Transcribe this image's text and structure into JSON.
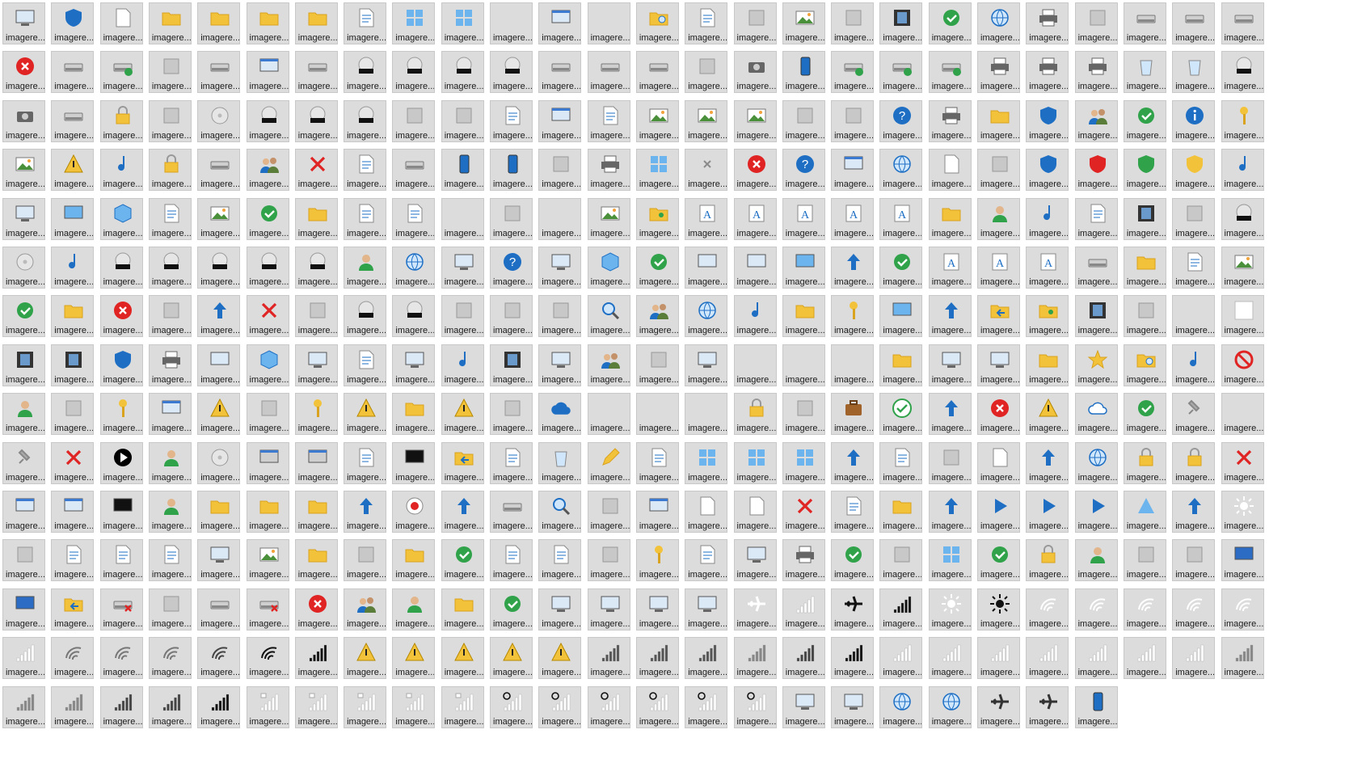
{
  "label": "imagere...",
  "icons": [
    [
      "monitor-settings-icon",
      "windows-shield-icon",
      "blank-document-icon",
      "folder-icon",
      "folder-icon",
      "folder-icon",
      "folder-open-icon",
      "magnifier-document-icon",
      "tiles-icon",
      "tiles-icon",
      "blank-icon",
      "window-icon",
      "blank-icon",
      "folder-search-icon",
      "document-lines-icon",
      "envelope-icon",
      "picture-icon",
      "ruler-sheet-icon",
      "film-strip-icon",
      "monitor-check-icon",
      "network-globe-icon",
      "printer-icon",
      "presentation-icon",
      "drive-icon",
      "drive-icon",
      "drive-icon"
    ],
    [
      "drive-error-icon",
      "drive-icon",
      "drive-green-icon",
      "chip-icon",
      "drive-icon",
      "drive-windows-icon",
      "disc-drive-icon",
      "dvd-r-icon",
      "dvd-ram-icon",
      "dvd-rom-icon",
      "dvd-rw-icon",
      "floppy-drive-icon",
      "drive-icon",
      "server-drive-icon",
      "network-pc-icon",
      "camcorder-icon",
      "phone-icon",
      "drive-network-ok-icon",
      "drive-network-ok-icon",
      "drive-network-ok-icon",
      "printer-icon",
      "printer-icon",
      "printer-green-icon",
      "recycle-bin-icon",
      "recycle-bin-icon",
      "dvd-drive-icon"
    ],
    [
      "camera-icon",
      "drive-icon",
      "lock-icon",
      "sd-card-icon",
      "disc-icon",
      "cd-r-icon",
      "cd-rom-icon",
      "cd-rw-icon",
      "notebook-icon",
      "audio-device-icon",
      "gear-document-icon",
      "settings-window-icon",
      "document-icon",
      "picture-frame-icon",
      "picture-icon",
      "landscape-icon",
      "network-share-icon",
      "network-share-icon",
      "help-drive-icon",
      "printer-icon",
      "font-folder-icon",
      "shield-icon",
      "users-icon",
      "checklist-screen-icon",
      "info-icon",
      "key-icon"
    ],
    [
      "picture-icon",
      "warning-icon",
      "music-disc-icon",
      "clock-circle-icon",
      "camera-drive-icon",
      "users-icon",
      "red-x-icon",
      "document-lines-icon",
      "drive-icon",
      "tablet-icon",
      "phone-icon",
      "projector-icon",
      "scanner-icon",
      "tiles-icon",
      "small-x-icon",
      "error-icon",
      "help-icon",
      "window-blue-icon",
      "globe-monitor-icon",
      "blank-document-icon",
      "cursor-icon",
      "shield-help-icon",
      "shield-error-icon",
      "shield-check-icon",
      "shield-warning-icon",
      "music-note-icon"
    ],
    [
      "laptop-icon",
      "screen-blue-icon",
      "package-icon",
      "document-lines-icon",
      "landscape-icon",
      "checklist-icon",
      "star-folder-icon",
      "list-icon",
      "clock-document-icon",
      "blank-icon",
      "network-icon",
      "blank-icon",
      "picture-icon",
      "user-folder-icon",
      "font-a-icon",
      "font-t-icon",
      "font-c-icon",
      "font-o-icon",
      "font-a-icon",
      "font-folder-icon",
      "briefcase-user-icon",
      "music-note-icon",
      "document-icon",
      "film-icon",
      "video-file-icon",
      "dvd-drive-icon"
    ],
    [
      "dvd-disc-icon",
      "music-disc-icon",
      "dvd-film-icon",
      "hd-dvd-icon",
      "bd-icon",
      "vcd-icon",
      "svcd-icon",
      "user-arrow-icon",
      "globe-icon",
      "monitor-search-icon",
      "help-icon",
      "monitor-sync-icon",
      "cube-icon",
      "laptop-check-icon",
      "chart-screen-icon",
      "screen-sync-icon",
      "screen-blue-icon",
      "refresh-icon",
      "check-small-icon",
      "font-t-icon",
      "font-c-icon",
      "font-o-icon",
      "camera-drive-icon",
      "zip-folder-icon",
      "shortcut-icon",
      "picture-icon"
    ],
    [
      "checklist-icon",
      "checklist-folder-icon",
      "drive-error-icon",
      "chart-icon",
      "download-icon",
      "red-x-icon",
      "transfer-icon",
      "dvd-r-icon",
      "dvd-rw-icon",
      "zip-icon",
      "green-zip-icon",
      "speaker-icon",
      "magnifier-icon",
      "users-icon",
      "globe-arrow-icon",
      "music-add-icon",
      "folder-pictures-icon",
      "keyboard-icon",
      "screen-blue-icon",
      "down-arrow-icon",
      "folder-arrow-icon",
      "user-folder-icon",
      "film-icon",
      "door-icon",
      "blank-icon",
      "blank-white-icon"
    ],
    [
      "film-frame-icon",
      "frame-icon",
      "shield-globe-icon",
      "scanner-icon",
      "keyboard-screen-icon",
      "cube-icon",
      "laptop-icon",
      "document-icon",
      "monitor-icon",
      "music-note-icon",
      "film-strip-icon",
      "laptop-dark-icon",
      "users-icon",
      "network-dots-icon",
      "monitor-icon",
      "blank-icon",
      "blank-icon",
      "blank-icon",
      "star-folder-icon",
      "monitor-picture-icon",
      "monitor-sync-icon",
      "folder-open-icon",
      "star-icon",
      "folder-search-icon",
      "music-note-icon",
      "no-entry-icon"
    ],
    [
      "user-icon",
      "pipe-icon",
      "key-hand-icon",
      "windows-pipe-icon",
      "windows-warning-icon",
      "pipe-icon",
      "key-hand-icon",
      "key-warning-icon",
      "folder-cloud-icon",
      "warning-small-icon",
      "ie-small-icon",
      "onedrive-icon",
      "blank-icon",
      "blank-icon",
      "blank-icon",
      "lock-icon",
      "resize-icon",
      "briefcase-icon",
      "check-circle-icon",
      "sync-icon",
      "error-icon",
      "warning-icon",
      "cloud-icon",
      "check-green-icon",
      "pin-icon",
      "blank-icon"
    ],
    [
      "pin-flat-icon",
      "close-red-icon",
      "play-circle-icon",
      "user-icon",
      "disc-file-icon",
      "window-dim-icon",
      "window-dim-icon",
      "clipboard-icon",
      "terminal-icon",
      "folder-back-icon",
      "documents-icon",
      "recycle-x-icon",
      "pencil-icon",
      "copy-icon",
      "grid-large-icon",
      "grid-small-icon",
      "grid-medium-icon",
      "redo-icon",
      "list-height-icon",
      "column-icon",
      "blank-document-icon",
      "undo-icon",
      "monitor-globe-icon",
      "clock-x-icon",
      "clock-x-icon",
      "red-x-icon"
    ],
    [
      "window-icon",
      "windows-icon",
      "terminal-icon",
      "terminal-user-icon",
      "folder-window-icon",
      "folder-drive-icon",
      "folder-grid-icon",
      "eject-icon",
      "record-icon",
      "refresh-stop-icon",
      "drive-icon",
      "zoom-icon",
      "calendar-icon",
      "copy-windows-icon",
      "blank-document-icon",
      "blank-document-icon",
      "dark-red-x-icon",
      "upload-document-icon",
      "upload-folder-icon",
      "upload-apps-icon",
      "play-icon",
      "windows-play-icon",
      "play-document-icon",
      "triangle-icon",
      "triangle-arrow-icon",
      "sunset-icon"
    ],
    [
      "cursor-icon",
      "undo-document-icon",
      "copy-arrow-icon",
      "edit-document-icon",
      "monitor-pen-icon",
      "photo-icon",
      "clock-folder-icon",
      "devices-icon",
      "check-folder-icon",
      "check-users-icon",
      "copy-green-icon",
      "undo-list-icon",
      "blue-panel-icon",
      "key-dots-icon",
      "list-picture-icon",
      "monitor-arrow-icon",
      "printer-copy-icon",
      "checklist-icon",
      "network-green-icon",
      "calendar-grid-icon",
      "check-document-icon",
      "clock-red-icon",
      "user-red-icon",
      "table-icon",
      "move-icon",
      "powershell-icon"
    ],
    [
      "powershell-icon",
      "folder-transfer-icon",
      "drive-x-icon",
      "network-pipe-icon",
      "server-arrow-icon",
      "server-x-icon",
      "drive-error-icon",
      "users-icon",
      "key-user-icon",
      "copy-folder-icon",
      "check-x-icon",
      "monitor-outline-icon",
      "monitor-outline-icon",
      "monitor-arrow-icon",
      "monitor-lock-icon",
      "airplane-white-icon",
      "signal-white-icon",
      "airplane-black-icon",
      "signal-black-icon",
      "sun-white-icon",
      "sun-black-icon",
      "wifi-white-icon",
      "wifi-white-icon",
      "wifi-white-icon",
      "wifi-white-icon",
      "wifi-white-icon"
    ],
    [
      "signal-white-icon",
      "wifi-gray-icon",
      "wifi-gray-icon",
      "wifi-gray-icon",
      "wifi-dark-icon",
      "wifi-black-icon",
      "signal-black-icon",
      "signal-warning-icon",
      "signal-warning-icon",
      "signal-warning-icon",
      "signal-warning-icon",
      "signal-warning-icon",
      "signal-outline-icon",
      "signal-outline-icon",
      "signal-outline-icon",
      "signal-gray-icon",
      "signal-dark-icon",
      "signal-black-icon",
      "signal-white-icon",
      "signal-white-icon",
      "signal-white-icon",
      "signal-white-icon",
      "signal-white-icon",
      "signal-white-icon",
      "signal-white-icon",
      "signal-gray-icon"
    ],
    [
      "signal-gray-icon",
      "signal-gray-icon",
      "signal-dark-icon",
      "signal-dark-icon",
      "signal-black-icon",
      "signal-lock-icon",
      "signal-lock-icon",
      "signal-lock-icon",
      "signal-lock-icon",
      "signal-lock-icon",
      "signal-sync-icon",
      "signal-sync-icon",
      "signal-sync-icon",
      "signal-sync-icon",
      "signal-sync-icon",
      "signal-sync-icon",
      "monitor-white-icon",
      "monitor-black-icon",
      "globe-blocked-icon",
      "globe-blocked-icon",
      "airplane-outline-icon",
      "airplane-outline-icon",
      "phone-icon"
    ]
  ]
}
